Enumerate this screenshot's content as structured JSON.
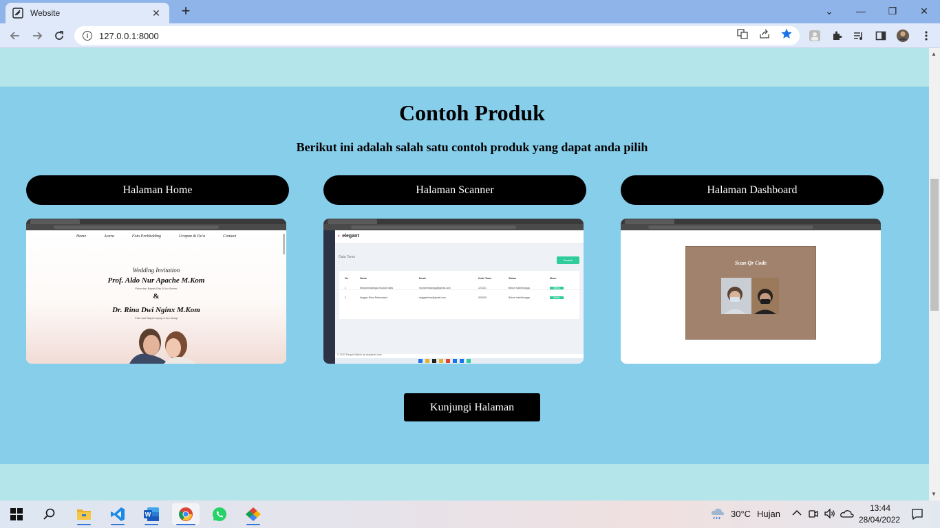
{
  "browser": {
    "tab_title": "Website",
    "tab_close": "✕",
    "new_tab": "+",
    "url": "127.0.0.1:8000",
    "window_controls": {
      "dropdown": "⌄",
      "minimize": "—",
      "restore": "❐",
      "close": "✕"
    }
  },
  "page": {
    "section_title": "Contoh Produk",
    "section_subtitle": "Berikut ini adalah salah satu contoh produk yang dapat anda pilih",
    "cards": [
      {
        "label": "Halaman Home"
      },
      {
        "label": "Halaman Scanner"
      },
      {
        "label": "Halaman Dashboard"
      }
    ],
    "visit_button": "Kunjungi Halaman"
  },
  "preview_home": {
    "nav": [
      "Home",
      "Acara",
      "Foto PreWedding",
      "Ucapan & Do'a",
      "Contact"
    ],
    "invite": "Wedding Invitation",
    "groom": "Prof. Aldo Nur Apache M.Kom",
    "groom_parents": "Putra dari Bapak Php & Ibu Server",
    "amp": "&",
    "bride": "Dr. Rina Dwi Nginx M.Kom",
    "bride_parents": "Putri dari Bapak Mysql & Ibu Nosql"
  },
  "preview_scanner": {
    "brand": "elegant",
    "page_title": "Data Tamu",
    "add_button": "Tambah",
    "columns": [
      "No",
      "Nama",
      "Email",
      "Kode Tamu",
      "Status",
      "Menu"
    ],
    "rows": [
      [
        "1",
        "Muhammadinga Ghozali Nafis",
        "muhammadinga@gmail.com",
        "121321",
        "Belum hadir/tunggu",
        "Menu"
      ],
      [
        "2",
        "Anggar Bima Rahmadani",
        "anggarbima@gmail.com",
        "000000",
        "Belum hadir/tunggu",
        "Menu"
      ]
    ],
    "footer": "© 2020 Elegant Admin by wrappixel.com"
  },
  "preview_dashboard": {
    "scan_title": "Scan Qr Code"
  },
  "taskbar": {
    "weather_temp": "30°C",
    "weather_text": "Hujan",
    "time": "13:44",
    "date": "28/04/2022"
  },
  "colors": {
    "page_background": "#b3e5ea",
    "section_background": "#87ceeb",
    "button_background": "#000000",
    "button_text": "#ffffff",
    "browser_accent": "#8fb4e9"
  }
}
